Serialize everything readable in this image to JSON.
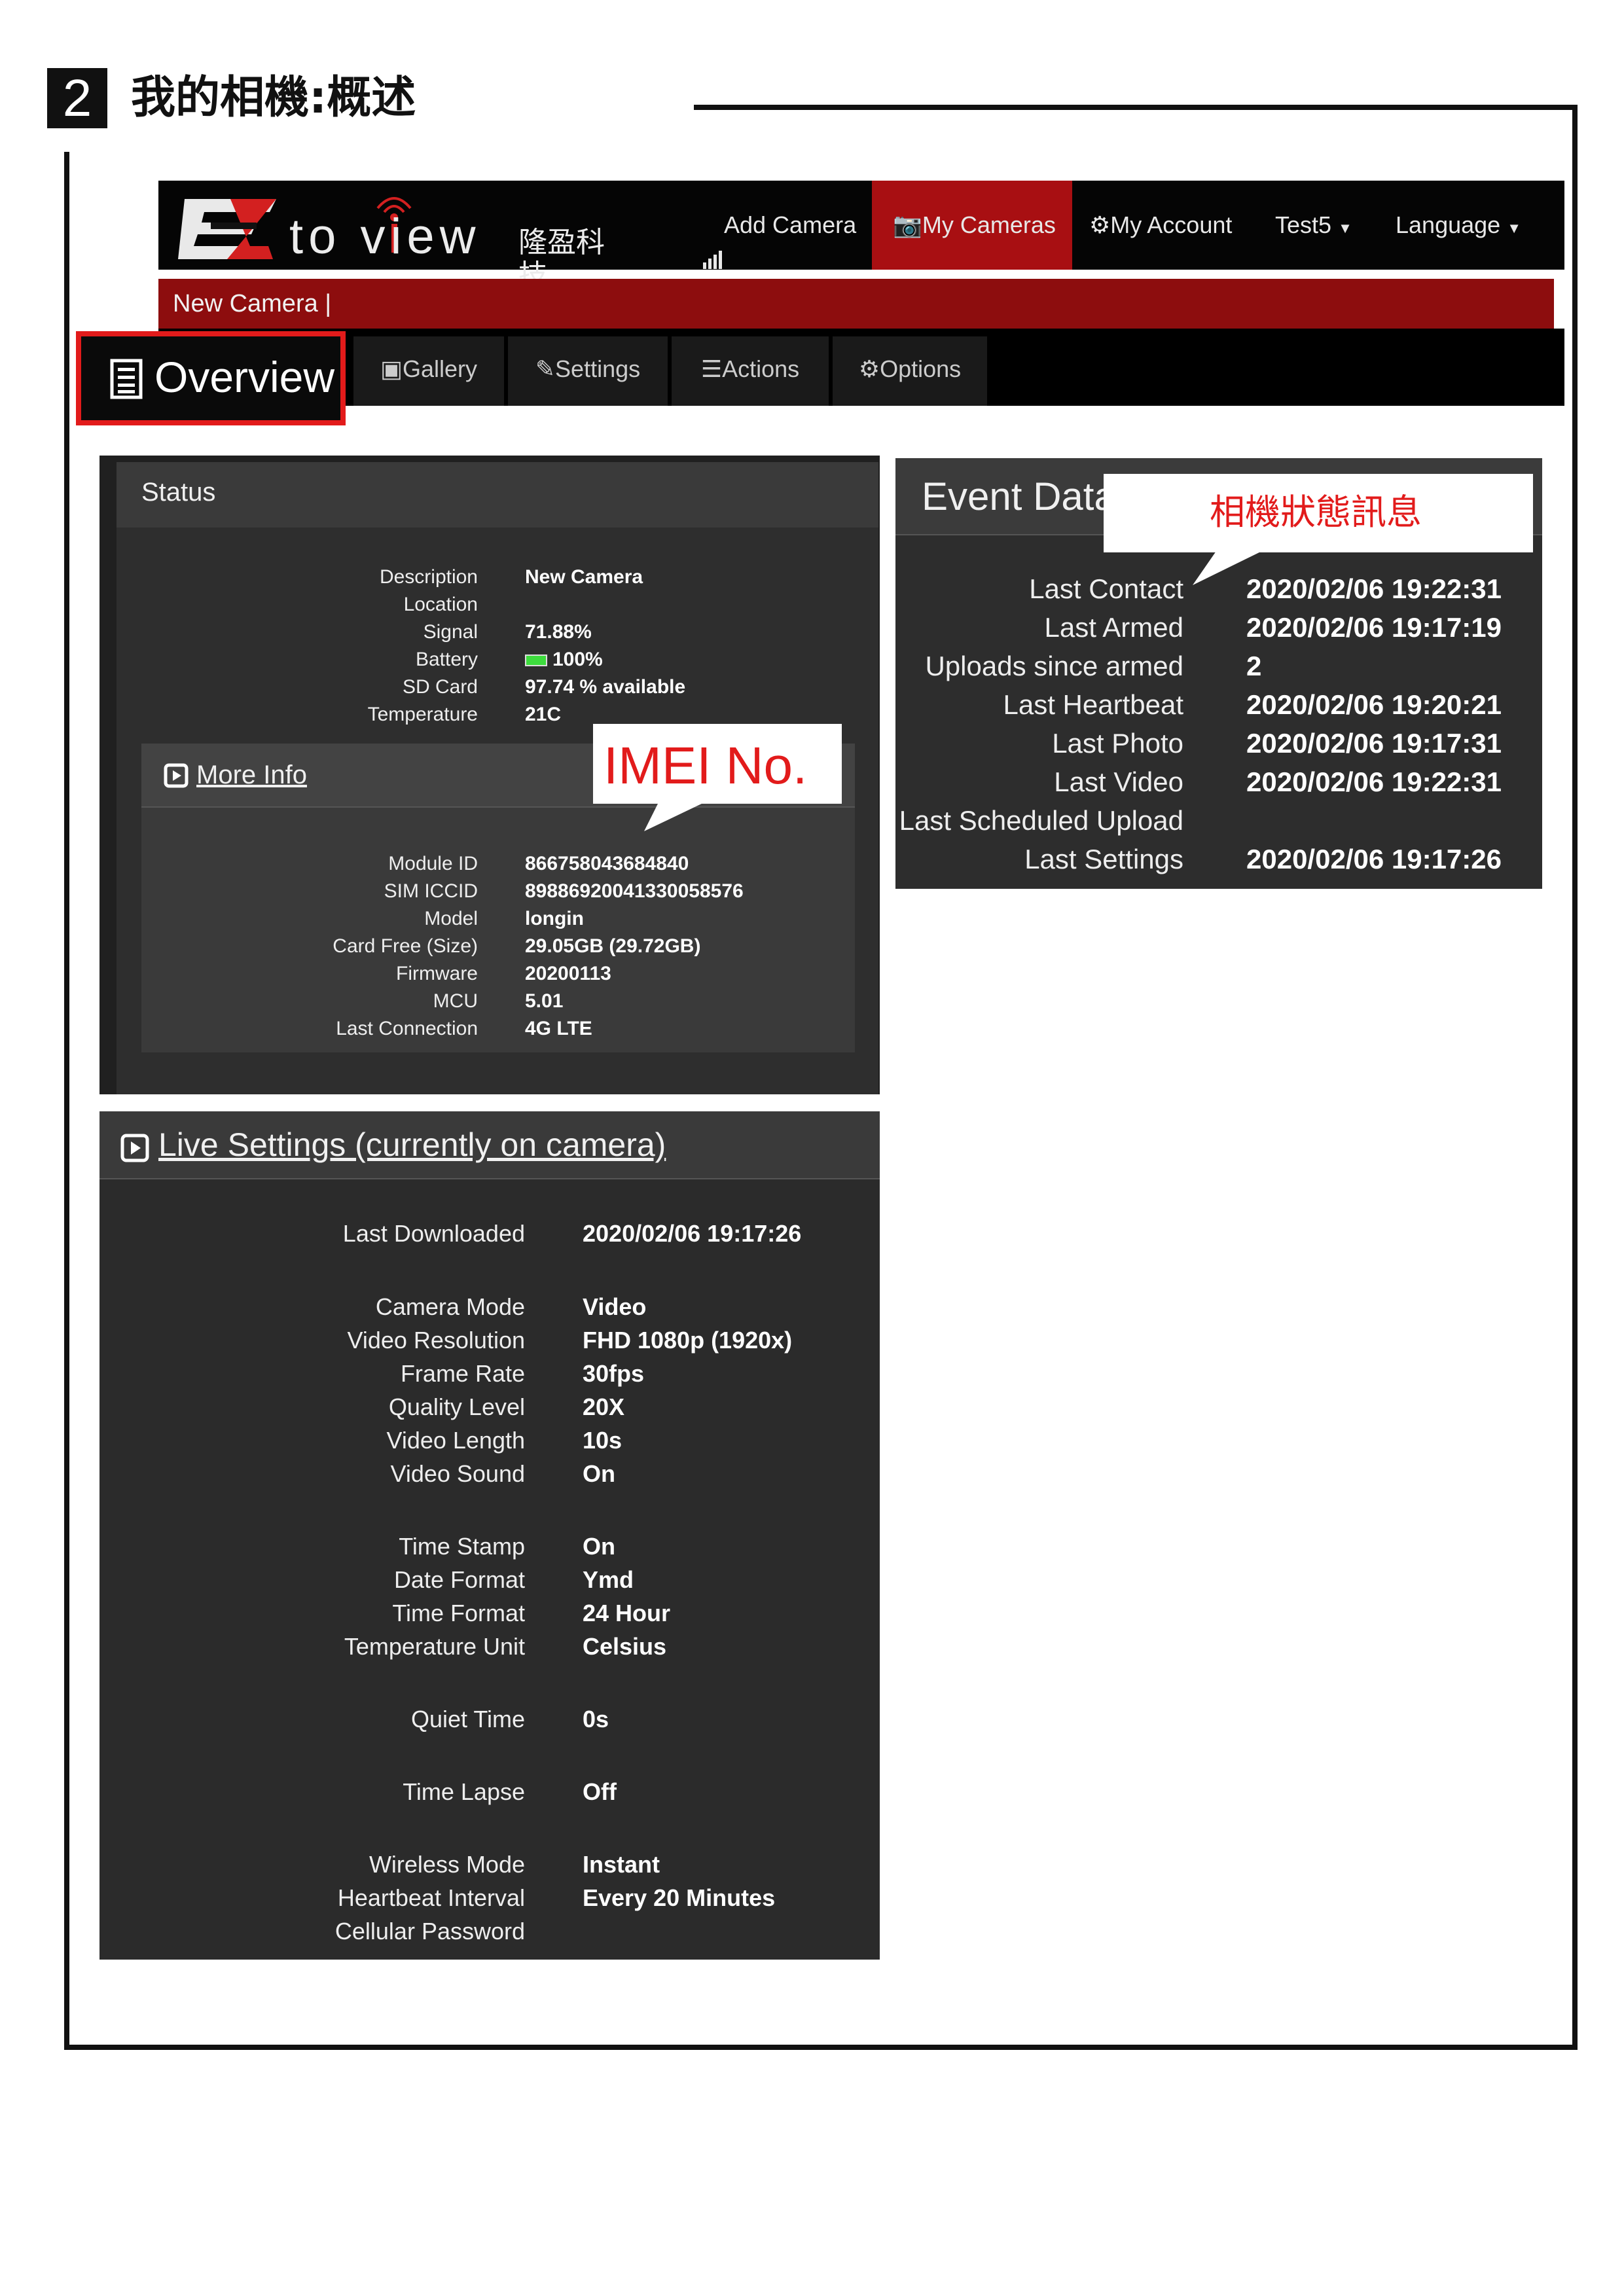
{
  "heading": {
    "step": "2",
    "title": "我的相機:概述"
  },
  "navbar": {
    "logo_text": "to view",
    "logo_cn": "隆盈科技",
    "items": [
      {
        "label": "Add Camera"
      },
      {
        "label": "My Cameras"
      },
      {
        "label": "My Account"
      },
      {
        "label": "Test5"
      },
      {
        "label": "Language"
      }
    ],
    "active_color": "#a80f12"
  },
  "subbar": {
    "text": "New Camera |"
  },
  "tabs": [
    {
      "label": "Overview"
    },
    {
      "label": "Gallery"
    },
    {
      "label": "Settings"
    },
    {
      "label": "Actions"
    },
    {
      "label": "Options"
    }
  ],
  "status": {
    "title": "Status",
    "rows": [
      {
        "label": "Description",
        "value": "New Camera"
      },
      {
        "label": "Location",
        "value": ""
      },
      {
        "label": "Signal",
        "value": "71.88%"
      },
      {
        "label": "Battery",
        "value": "100%"
      },
      {
        "label": "SD Card",
        "value": "97.74 % available"
      },
      {
        "label": "Temperature",
        "value": "21C"
      }
    ],
    "battery_color": "#3ddc3d"
  },
  "more_info": {
    "title": "More Info",
    "rows": [
      {
        "label": "Module ID",
        "value": "866758043684840"
      },
      {
        "label": "SIM ICCID",
        "value": "89886920041330058576"
      },
      {
        "label": "Model",
        "value": "longin"
      },
      {
        "label": "Card Free (Size)",
        "value": "29.05GB (29.72GB)"
      },
      {
        "label": "Firmware",
        "value": "20200113"
      },
      {
        "label": "MCU",
        "value": "5.01"
      },
      {
        "label": "Last Connection",
        "value": "4G LTE"
      }
    ]
  },
  "imei_callout": {
    "text": "IMEI No.",
    "color": "#e21b1b"
  },
  "event_data": {
    "title": "Event Data",
    "rows": [
      {
        "label": "Last Contact",
        "value": "2020/02/06 19:22:31"
      },
      {
        "label": "Last Armed",
        "value": "2020/02/06 19:17:19"
      },
      {
        "label": "Uploads since armed",
        "value": "2"
      },
      {
        "label": "Last Heartbeat",
        "value": "2020/02/06 19:20:21"
      },
      {
        "label": "Last Photo",
        "value": "2020/02/06 19:17:31"
      },
      {
        "label": "Last Video",
        "value": "2020/02/06 19:22:31"
      },
      {
        "label": "Last Scheduled Upload",
        "value": ""
      },
      {
        "label": "Last Settings",
        "value": "2020/02/06 19:17:26"
      }
    ]
  },
  "status_callout": {
    "text": "相機狀態訊息",
    "color": "#e21b1b"
  },
  "live_settings": {
    "title": "Live Settings (currently on camera)",
    "rows": [
      {
        "label": "Last Downloaded",
        "value": "2020/02/06 19:17:26"
      },
      {
        "label": "Camera Mode",
        "value": "Video"
      },
      {
        "label": "Video Resolution",
        "value": "FHD 1080p (1920x)"
      },
      {
        "label": "Frame Rate",
        "value": "30fps"
      },
      {
        "label": "Quality Level",
        "value": "20X"
      },
      {
        "label": "Video Length",
        "value": "10s"
      },
      {
        "label": "Video Sound",
        "value": "On"
      },
      {
        "label": "Time Stamp",
        "value": "On"
      },
      {
        "label": "Date Format",
        "value": "Ymd"
      },
      {
        "label": "Time Format",
        "value": "24 Hour"
      },
      {
        "label": "Temperature Unit",
        "value": "Celsius"
      },
      {
        "label": "Quiet Time",
        "value": "0s"
      },
      {
        "label": "Time Lapse",
        "value": "Off"
      },
      {
        "label": "Wireless Mode",
        "value": "Instant"
      },
      {
        "label": "Heartbeat Interval",
        "value": "Every 20 Minutes"
      },
      {
        "label": "Cellular Password",
        "value": ""
      }
    ]
  }
}
